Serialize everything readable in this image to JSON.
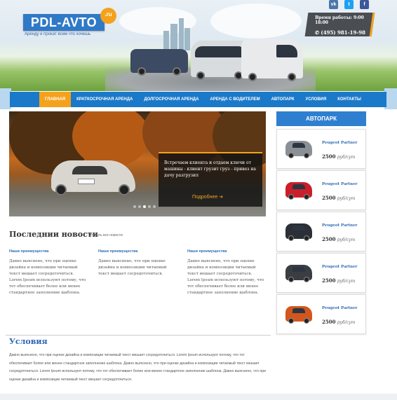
{
  "header": {
    "logo": "PDL-AVTO",
    "logo_badge": ".ru",
    "tagline": "Аренду и прокат всем что хочешь",
    "hours": "Время работы: 9:00 18:00",
    "phone": "(495) 981-19-98",
    "social": [
      {
        "name": "vk-icon",
        "glyph": "vk",
        "color": "#4a76a8"
      },
      {
        "name": "twitter-icon",
        "glyph": "t",
        "color": "#1da1f2"
      },
      {
        "name": "facebook-icon",
        "glyph": "f",
        "color": "#3b5998"
      }
    ]
  },
  "nav": {
    "items": [
      "Главная",
      "Краткосрочная аренда",
      "Долгосрочная аренда",
      "Аренда с водителем",
      "Автопарк",
      "Условия",
      "Контакты"
    ]
  },
  "slider": {
    "caption": "Встречаем клиента и отдаем ключи от машины - клиент грузит груз - привез на дачу разгрузил",
    "more": "Подробнее",
    "dots": 5,
    "active_dot": 3
  },
  "news": {
    "title": "Последнии новости",
    "link": "Открыть все новости",
    "columns": [
      {
        "heading": "Наши преимущества",
        "text": "Давно выяснено, что при оценке дизайна и композиции читаемый текст мешает сосредоточиться. Lorem Ipsum используют потому, что тот обеспечивает более или менее стандартное заполнение шаблона."
      },
      {
        "heading": "Наши преимущества",
        "text": "Давно выяснено, что при оценке дизайна и композиции читаемый текст мешает сосредоточиться."
      },
      {
        "heading": "Наши преимущества",
        "text": "Давно выяснено, что при оценке дизайна и композиции читаемый текст мешает сосредоточиться. Lorem Ipsum используют потому, что тот обеспечивает более или менее стандартное заполнение шаблона."
      }
    ]
  },
  "usloviya": {
    "title": "Условия",
    "text": "Давно выяснено, что при оценке дизайна и композиции читаемый текст мешает сосредоточиться. Lorem Ipsum используют потому, что тот обеспечивает более или менее стандартное заполнение шаблона. Давно выяснено, что при оценке дизайна и композиции читаемый текст мешает сосредоточиться. Lorem Ipsum используют потому, что тот обеспечивает более или менее стандартное заполнение шаблона. Давно выяснено, что при оценке дизайна и композиции читаемый текст мешает сосредоточиться."
  },
  "sidebar": {
    "title": "Автопарк",
    "items": [
      {
        "name": "Peugeot Partner",
        "price": "2500",
        "unit": "руб/сут",
        "color": "#8a9096"
      },
      {
        "name": "Peugeot Partner",
        "price": "2500",
        "unit": "руб/сут",
        "color": "#c81f2a"
      },
      {
        "name": "Peugeot Partner",
        "price": "2500",
        "unit": "руб/сут",
        "color": "#2b2f36"
      },
      {
        "name": "Peugeot Partner",
        "price": "2500",
        "unit": "руб/сут",
        "color": "#3a3d42"
      },
      {
        "name": "Peugeot Partner",
        "price": "2500",
        "unit": "руб/сут",
        "color": "#d2561e"
      }
    ]
  },
  "colors": {
    "accent": "#f4a21c",
    "brand_blue": "#1b79c9"
  }
}
